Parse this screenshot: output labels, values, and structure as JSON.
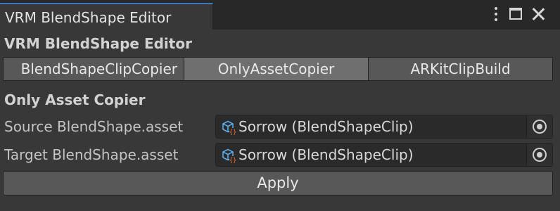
{
  "window": {
    "tab_title": "VRM BlendShape Editor",
    "controls": [
      "kebab-menu",
      "maximize",
      "close"
    ]
  },
  "heading": "VRM BlendShape Editor",
  "toolbar": {
    "tabs": [
      {
        "label": "BlendShapeClipCopier",
        "active": false
      },
      {
        "label": "OnlyAssetCopier",
        "active": true
      },
      {
        "label": "ARKitClipBuild",
        "active": false
      }
    ]
  },
  "section_title": "Only Asset Copier",
  "fields": [
    {
      "label": "Source BlendShape.asset",
      "value": "Sorrow (BlendShapeClip)"
    },
    {
      "label": "Target BlendShape.asset",
      "value": "Sorrow (BlendShapeClip)"
    }
  ],
  "apply_label": "Apply",
  "colors": {
    "accent": "#3a79bb",
    "background": "#383838",
    "button": "#585858",
    "button_active": "#6f6f6f"
  }
}
